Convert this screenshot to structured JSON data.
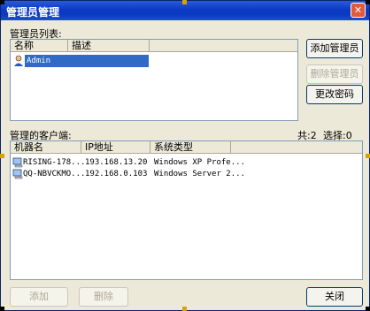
{
  "window": {
    "title": "管理员管理",
    "close_glyph": "✕"
  },
  "admin_section": {
    "label": "管理员列表:",
    "columns": [
      "名称",
      "描述"
    ],
    "rows": [
      {
        "name": "Admin",
        "desc": "",
        "selected": true
      }
    ]
  },
  "buttons": {
    "add_admin": "添加管理员",
    "delete_admin": "删除管理员",
    "change_password": "更改密码",
    "add": "添加",
    "delete": "删除",
    "close": "关闭"
  },
  "client_section": {
    "label": "管理的客户端:",
    "total_label": "共:2",
    "selected_label": "选择:0",
    "columns": [
      "机器名",
      "IP地址",
      "系统类型"
    ],
    "rows": [
      {
        "machine": "RISING-178...",
        "ip": "193.168.13.20",
        "os": "Windows XP Profe..."
      },
      {
        "machine": "QQ-NBVCKMO...",
        "ip": "192.168.0.103",
        "os": "Windows Server 2..."
      }
    ]
  },
  "colors": {
    "title_bar": "#0a39c7",
    "selection": "#316ac5",
    "window_bg": "#ece9d8"
  }
}
